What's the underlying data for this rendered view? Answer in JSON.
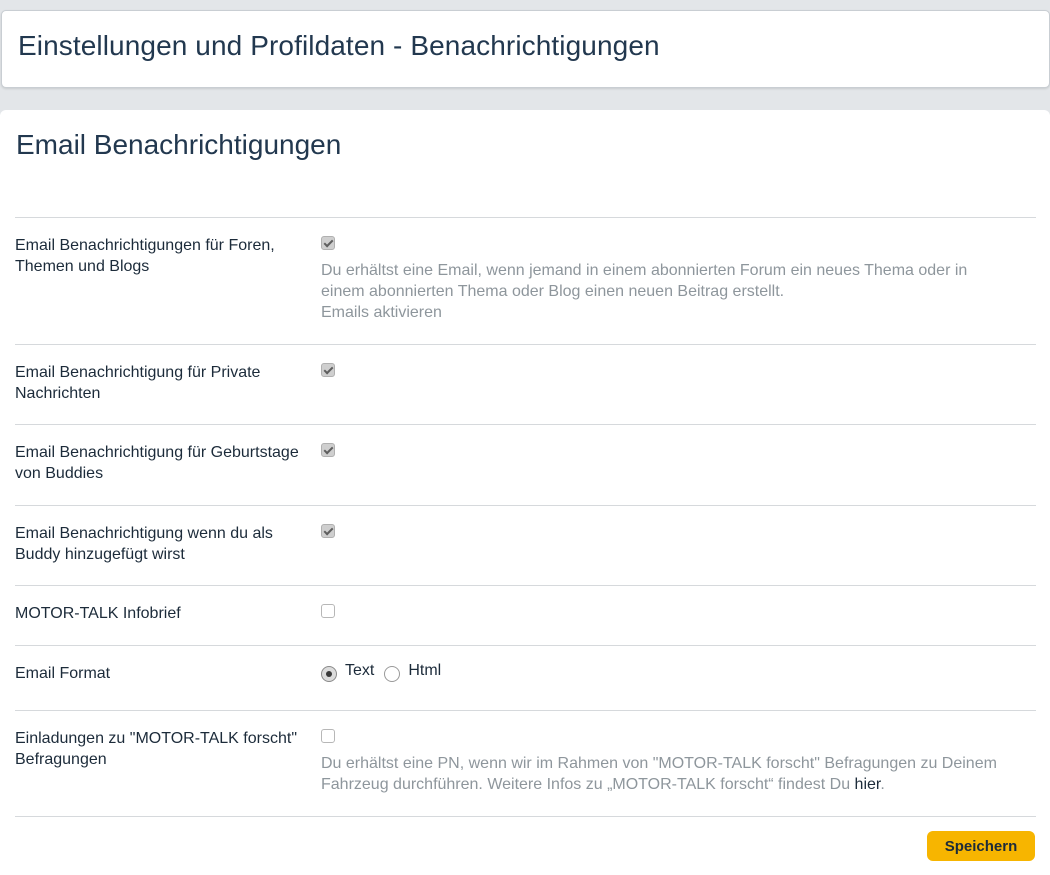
{
  "header": {
    "title": "Einstellungen und Profildaten - Benachrichtigungen"
  },
  "section": {
    "title": "Email Benachrichtigungen"
  },
  "settings": [
    {
      "label": "Email Benachrichtigungen für Foren, Themen und Blogs",
      "type": "checkbox",
      "checked": true,
      "description": [
        "Du erhältst eine Email, wenn jemand in einem abonnierten Forum ein neues Thema oder in",
        "einem abonnierten Thema oder Blog einen neuen Beitrag erstellt.",
        "Emails aktivieren"
      ]
    },
    {
      "label": "Email Benachrichtigung für Private Nachrichten",
      "type": "checkbox",
      "checked": true
    },
    {
      "label": "Email Benachrichtigung für Geburtstage von Buddies",
      "type": "checkbox",
      "checked": true
    },
    {
      "label": "Email Benachrichtigung wenn du als Buddy hinzugefügt wirst",
      "type": "checkbox",
      "checked": true
    },
    {
      "label": "MOTOR-TALK Infobrief",
      "type": "checkbox",
      "checked": false
    },
    {
      "label": "Email Format",
      "type": "radio",
      "options": [
        "Text",
        "Html"
      ],
      "selected": "Text"
    },
    {
      "label": "Einladungen zu \"MOTOR-TALK forscht\" Befragungen",
      "type": "checkbox",
      "checked": false,
      "description_line1": "Du erhältst eine PN, wenn wir im Rahmen von \"MOTOR-TALK forscht\" Befragungen zu Deinem",
      "description_line2": "Fahrzeug durchführen. Weitere Infos zu „MOTOR-TALK forscht“ findest Du ",
      "description_link": "hier",
      "description_end": "."
    }
  ],
  "actions": {
    "save_label": "Speichern"
  },
  "colors": {
    "accent": "#f7b500",
    "heading": "#22384f",
    "muted_text": "#8e969c",
    "background": "#e3e6e9"
  }
}
